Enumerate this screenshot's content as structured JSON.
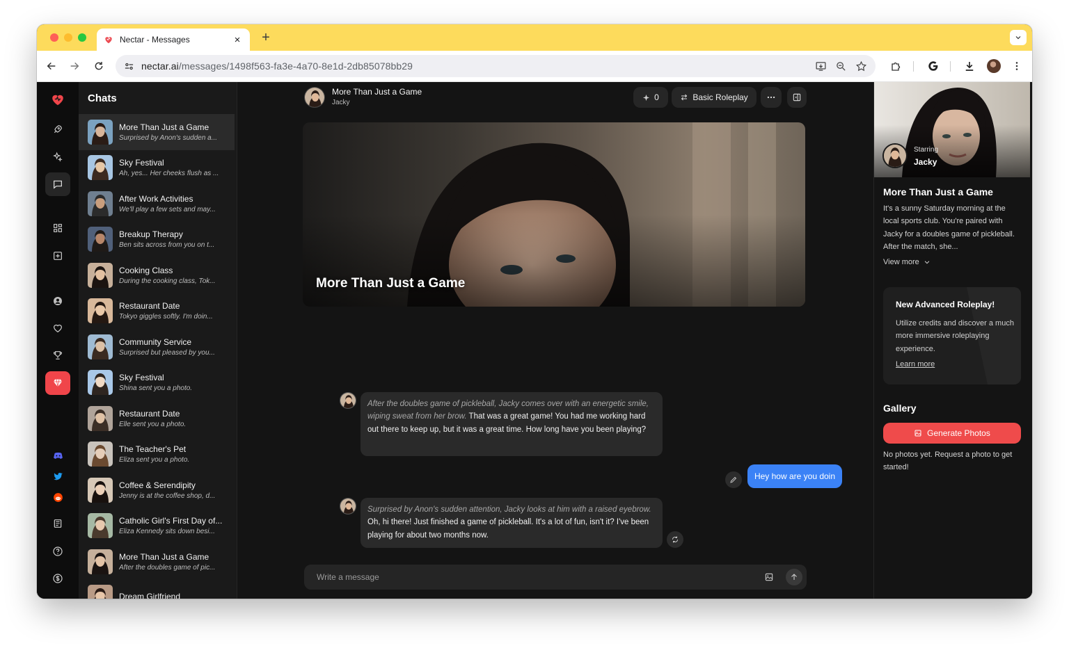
{
  "browser": {
    "tab_title": "Nectar - Messages",
    "url_host": "nectar.ai",
    "url_path": "/messages/1498f563-fa3e-4a70-8e1d-2db85078bb29",
    "accent": "#fddb5c"
  },
  "sidebar": {
    "title": "Chats",
    "accent": "#f0454a",
    "nav_icons": [
      "heart-logo-icon",
      "rocket-icon",
      "sparkles-icon",
      "chat-bubble-icon",
      "grid-icon",
      "plus-square-icon",
      "user-icon",
      "heart-icon",
      "trophy-icon",
      "gem-icon",
      "discord-icon",
      "twitter-icon",
      "reddit-icon",
      "book-icon",
      "help-icon",
      "dollar-icon"
    ]
  },
  "chats": [
    {
      "name": "More Than Just a Game",
      "preview": "Surprised by Anon's sudden a...",
      "selected": true
    },
    {
      "name": "Sky Festival",
      "preview": "Ah, yes... Her cheeks flush as ..."
    },
    {
      "name": "After Work Activities",
      "preview": "We'll play a few sets and may..."
    },
    {
      "name": "Breakup Therapy",
      "preview": "Ben sits across from you on t..."
    },
    {
      "name": "Cooking Class",
      "preview": "During the cooking class, Tok..."
    },
    {
      "name": "Restaurant Date",
      "preview": "Tokyo giggles softly. I'm doin..."
    },
    {
      "name": "Community Service",
      "preview": "Surprised but pleased by you..."
    },
    {
      "name": "Sky Festival",
      "preview": "Shina sent you a photo."
    },
    {
      "name": "Restaurant Date",
      "preview": "Elle sent you a photo."
    },
    {
      "name": "The Teacher's Pet",
      "preview": "Eliza sent you a photo."
    },
    {
      "name": "Coffee & Serendipity",
      "preview": "Jenny is at the coffee shop, d..."
    },
    {
      "name": "Catholic Girl's First Day of...",
      "preview": "Eliza Kennedy sits down besi..."
    },
    {
      "name": "More Than Just a Game",
      "preview": "After the doubles game of pic..."
    },
    {
      "name": "Dream Girlfriend",
      "preview": ""
    }
  ],
  "conversation": {
    "title": "More Than Just a Game",
    "character": "Jacky",
    "credits": "0",
    "mode": "Basic Roleplay",
    "hero_title": "More Than Just a Game",
    "messages": [
      {
        "role": "character",
        "action": "After the doubles game of pickleball, Jacky comes over with an energetic smile, wiping sweat from her brow.",
        "text": "That was a great game! You had me working hard out there to keep up, but it was a great time. How long have you been playing?"
      },
      {
        "role": "user",
        "text": "Hey how are you doin"
      },
      {
        "role": "character",
        "action": "Surprised by Anon's sudden attention, Jacky looks at him with a raised eyebrow.",
        "text": "Oh, hi there! Just finished a game of pickleball. It's a lot of fun, isn't it? I've been playing for about two months now."
      }
    ],
    "composer_placeholder": "Write a message",
    "user_bubble_color": "#3b82f6"
  },
  "details": {
    "starring_label": "Starring",
    "starring_name": "Jacky",
    "title": "More Than Just a Game",
    "description": "It's a sunny Saturday morning at the local sports club. You're paired with Jacky for a doubles game of pickleball. After the match, she...",
    "view_more": "View more",
    "promo": {
      "title": "New Advanced Roleplay!",
      "description": "Utilize credits and discover a much more immersive roleplaying experience.",
      "link": "Learn more"
    },
    "gallery_title": "Gallery",
    "generate_button": "Generate Photos",
    "empty_text": "No photos yet. Request a photo to get started!",
    "button_color": "#ef4b4b"
  }
}
